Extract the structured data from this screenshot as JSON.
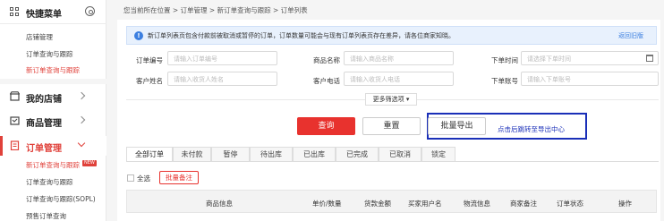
{
  "sidebar": {
    "title": "快捷菜单",
    "quick_items": [
      "店铺管理",
      "订单查询与跟踪",
      "新订单查询与跟踪"
    ],
    "groups": {
      "store": "我的店铺",
      "goods": "商品管理",
      "orders": "订单管理"
    },
    "order_items": [
      "新订单查询与跟踪",
      "订单查询与跟踪",
      "订单查询与跟踪(SOPL)",
      "预售订单查询"
    ],
    "new_badge": "NEW"
  },
  "breadcrumb": "您当前所在位置 > 订单管理 > 新订单查询与跟踪 > 订单列表",
  "notice": {
    "text": "新订单列表页包含付款前被取消或暂停的订单，订单数量可能会与现有订单列表页存在差异，请各位商家知晓。",
    "link": "返回旧版"
  },
  "filters": {
    "order_no": {
      "label": "订单编号",
      "placeholder": "请输入订单编号"
    },
    "goods_name": {
      "label": "商品名称",
      "placeholder": "请输入商品名称"
    },
    "order_time": {
      "label": "下单时间",
      "placeholder": "请选择下单时间"
    },
    "customer_name": {
      "label": "客户姓名",
      "placeholder": "请输入收货人姓名"
    },
    "customer_phone": {
      "label": "客户电话",
      "placeholder": "请输入收货人电话"
    },
    "order_account": {
      "label": "下单账号",
      "placeholder": "请输入下单账号"
    }
  },
  "more_options": "更多筛选项 ▾",
  "buttons": {
    "query": "查询",
    "reset": "重置",
    "export": "批量导出"
  },
  "annotation": "点击后跳转至导出中心",
  "tabs": [
    "全部订单",
    "未付款",
    "暂停",
    "待出库",
    "已出库",
    "已完成",
    "已取消",
    "锁定"
  ],
  "select_all": "全选",
  "batch_remark": "批量备注",
  "table_headers": [
    "商品信息",
    "单价/数量",
    "货款金额",
    "买家用户名",
    "物流信息",
    "商家备注",
    "订单状态",
    "操作"
  ],
  "colors": {
    "accent": "#e8322e",
    "highlight": "#1a2fb8",
    "info": "#3c7fe0"
  }
}
